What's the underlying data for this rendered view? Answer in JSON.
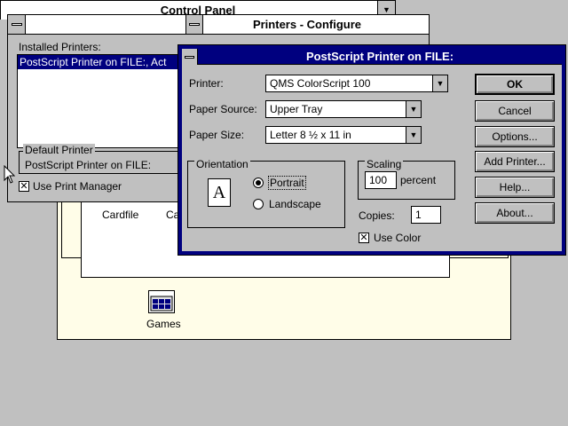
{
  "control_panel": {
    "title": "Control Panel"
  },
  "program_group": {
    "items": [
      {
        "label": "Cardfile"
      },
      {
        "label": "Ca"
      },
      {
        "label": "Games"
      }
    ]
  },
  "printers": {
    "title": "Printers - Configure",
    "installed_label": "Installed Printers:",
    "installed_items": [
      "PostScript Printer on FILE:, Act"
    ],
    "default_group_label": "Default Printer",
    "default_value": "PostScript Printer on FILE:",
    "use_print_manager_label": "Use Print Manager",
    "use_print_manager_checked": true
  },
  "dialog": {
    "title": "PostScript Printer on FILE:",
    "printer_label": "Printer:",
    "printer_value": "QMS ColorScript 100",
    "paper_source_label": "Paper Source:",
    "paper_source_value": "Upper Tray",
    "paper_size_label": "Paper Size:",
    "paper_size_value": "Letter 8 ½ x 11 in",
    "orientation_label": "Orientation",
    "orientation_icon_letter": "A",
    "portrait_label": "Portrait",
    "landscape_label": "Landscape",
    "orientation_selected": "Portrait",
    "scaling_label": "Scaling",
    "scaling_value": "100",
    "scaling_unit": "percent",
    "copies_label": "Copies:",
    "copies_value": "1",
    "use_color_label": "Use Color",
    "use_color_checked": true,
    "buttons": {
      "ok": "OK",
      "cancel": "Cancel",
      "options": "Options...",
      "add_printer": "Add Printer...",
      "help": "Help...",
      "about": "About..."
    }
  },
  "colors": {
    "desktop": "#c0c0c0",
    "active_title": "#00007f",
    "program_group_bg": "#fffde8"
  }
}
